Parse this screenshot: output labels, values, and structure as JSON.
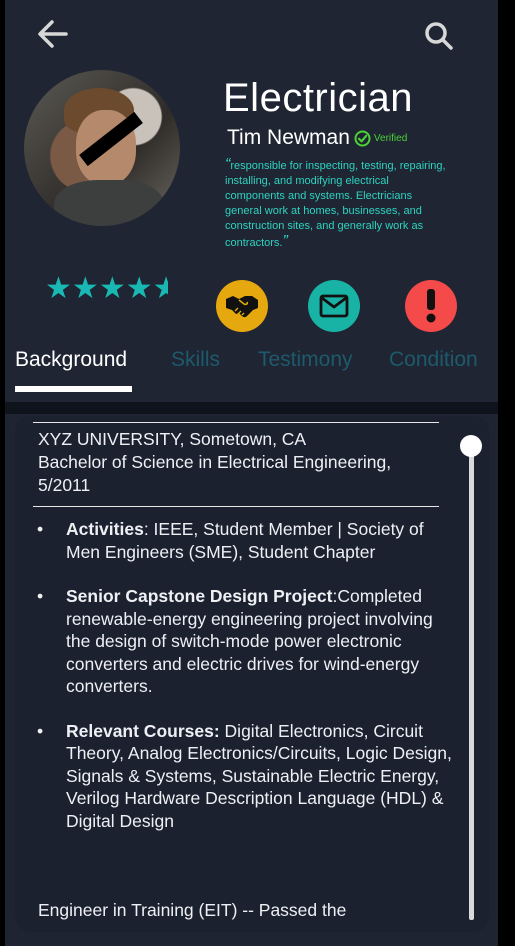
{
  "header": {
    "back_icon": "arrow-left-icon",
    "search_icon": "search-icon"
  },
  "profile": {
    "title": "Electrician",
    "name": "Tim Newman",
    "verified_label": "Verified",
    "bio_open_quote": "“",
    "bio": "responsible for inspecting, testing, repairing, installing, and modifying electrical components and systems. Electricians general work at homes, businesses, and construction sites, and generally work as contractors.",
    "bio_close_quote": "”",
    "rating": 4.5,
    "rating_max": 5,
    "star_color": "#19b8b3"
  },
  "actions": [
    {
      "icon": "handshake-icon",
      "color": "#e5a80e"
    },
    {
      "icon": "mail-icon",
      "color": "#19b3a6"
    },
    {
      "icon": "exclamation-icon",
      "color": "#f44a4a"
    }
  ],
  "tabs": [
    {
      "label": "Background",
      "active": true
    },
    {
      "label": "Skills",
      "active": false
    },
    {
      "label": "Testimony",
      "active": false
    },
    {
      "label": "Condition",
      "active": false
    }
  ],
  "background": {
    "education": {
      "line1": "XYZ UNIVERSITY, Sometown, CA",
      "line2": "Bachelor of Science in Electrical Engineering, 5/2011"
    },
    "items": [
      {
        "label": "Activities",
        "sep": ": ",
        "text": "IEEE, Student Member | Society of Men Engineers (SME), Student Chapter"
      },
      {
        "label": "Senior Capstone Design Project",
        "sep": ":",
        "text": "Completed renewable-energy engineering project involving the design of switch-mode power electronic converters and electric drives for wind-energy converters."
      },
      {
        "label": "Relevant Courses:",
        "sep": " ",
        "text": "Digital Electronics, Circuit Theory, Analog Electronics/Circuits, Logic Design, Signals & Systems, Sustainable Electric Energy, Verilog Hardware Description Language (HDL) & Digital Design"
      }
    ],
    "trailing": "Engineer in Training (EIT) -- Passed the"
  }
}
